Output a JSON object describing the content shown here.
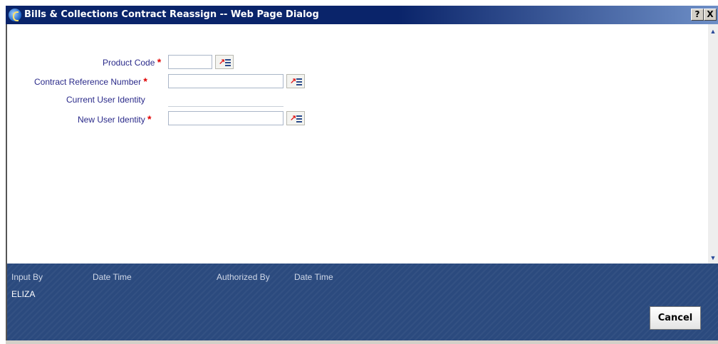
{
  "window": {
    "title": "Bills & Collections Contract Reassign -- Web Page Dialog",
    "help_label": "?",
    "close_label": "X"
  },
  "form": {
    "product_code": {
      "label": "Product Code",
      "required_mark": "*",
      "value": ""
    },
    "contract_ref": {
      "label": "Contract Reference Number",
      "required_mark": "*",
      "value": ""
    },
    "current_user": {
      "label": "Current User Identity",
      "value": ""
    },
    "new_user": {
      "label": "New User Identity",
      "required_mark": "*",
      "value": ""
    }
  },
  "footer": {
    "input_by_label": "Input By",
    "date_time_label_1": "Date Time",
    "authorized_by_label": "Authorized By",
    "date_time_label_2": "Date Time",
    "input_by_value": "ELIZA",
    "cancel_label": "Cancel"
  },
  "icons": {
    "app": "ie-icon",
    "lov": "list-of-values-icon",
    "scroll_up": "scroll-up-arrow-icon",
    "scroll_down": "scroll-down-arrow-icon"
  },
  "colors": {
    "titlebar": "#0a246a",
    "footer": "#2b4a7e",
    "label": "#2a2a8a",
    "required": "#e00000"
  }
}
